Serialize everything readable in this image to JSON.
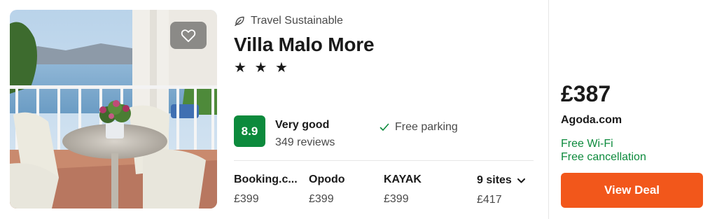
{
  "hotel": {
    "tag": "Travel Sustainable",
    "name": "Villa Malo More",
    "stars": "★ ★ ★",
    "rating_score": "8.9",
    "rating_label": "Very good",
    "reviews": "349 reviews",
    "amenity": "Free parking"
  },
  "photo": {
    "favorite_icon": "heart-icon"
  },
  "sites": [
    {
      "name": "Booking.c...",
      "price": "£399"
    },
    {
      "name": "Opodo",
      "price": "£399"
    },
    {
      "name": "KAYAK",
      "price": "£399"
    }
  ],
  "more_sites": {
    "label": "9 sites",
    "price": "£417"
  },
  "deal": {
    "price": "£387",
    "provider": "Agoda.com",
    "perks": [
      "Free Wi-Fi",
      "Free cancellation"
    ],
    "button": "View Deal"
  },
  "colors": {
    "rating_badge": "#0c8a3c",
    "perk_text": "#0c8a3c",
    "deal_button": "#f2571b"
  }
}
